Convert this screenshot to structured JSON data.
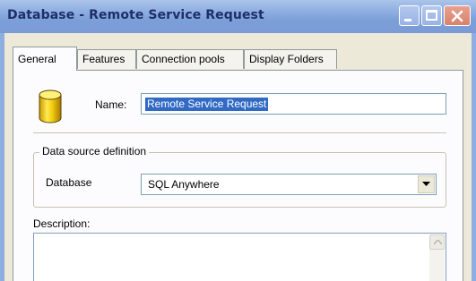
{
  "window": {
    "title": "Database - Remote Service Request",
    "title_color": "#1e2f68",
    "titlebar_color": "#8eaee0"
  },
  "tabs": [
    {
      "label": "General",
      "active": true
    },
    {
      "label": "Features",
      "active": false
    },
    {
      "label": "Connection pools",
      "active": false
    },
    {
      "label": "Display Folders",
      "active": false
    }
  ],
  "general": {
    "icon": "database-icon",
    "name_label": "Name:",
    "name_value": "Remote Service Request",
    "group_label": "Data source definition",
    "database_label": "Database",
    "database_value": "SQL Anywhere",
    "description_label": "Description:",
    "description_value": ""
  },
  "colors": {
    "selection": "#316ac5",
    "panel_background": "#fcfcfe",
    "window_background": "#ece9d8"
  }
}
